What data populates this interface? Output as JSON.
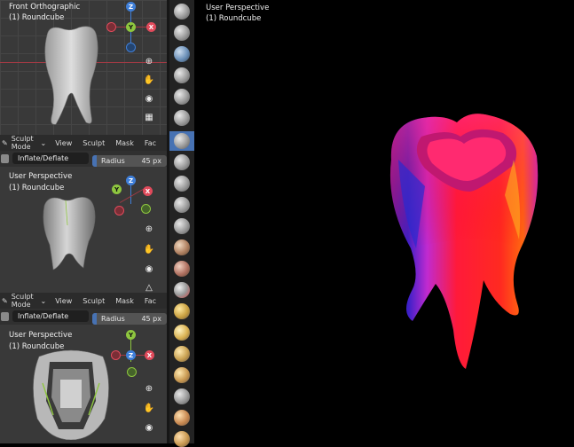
{
  "viewport_top": {
    "title": "Front Orthographic",
    "object": "(1) Roundcube"
  },
  "header": {
    "mode": "Sculpt Mode",
    "menus": [
      "View",
      "Sculpt",
      "Mask",
      "Fac"
    ]
  },
  "toolbar": {
    "brush_name": "Inflate/Deflate",
    "radius_label": "Radius",
    "radius_value": "45 px"
  },
  "viewport_mid": {
    "title": "User Perspective",
    "object": "(1) Roundcube"
  },
  "header2": {
    "mode": "Sculpt Mode",
    "menus": [
      "View",
      "Sculpt",
      "Mask",
      "Fac"
    ]
  },
  "toolbar2": {
    "brush_name": "Inflate/Deflate",
    "radius_label": "Radius",
    "radius_value": "45 px"
  },
  "viewport_bottom": {
    "title": "User Perspective",
    "object": "(1) Roundcube"
  },
  "main_viewport": {
    "title": "User Perspective",
    "object": "(1) Roundcube"
  },
  "gizmo": {
    "x": "X",
    "y": "Y",
    "z": "Z"
  },
  "colors": {
    "x_axis": "#e04a5b",
    "y_axis": "#8ec63f",
    "z_axis": "#3f7fd9",
    "active": "#4772b3"
  }
}
